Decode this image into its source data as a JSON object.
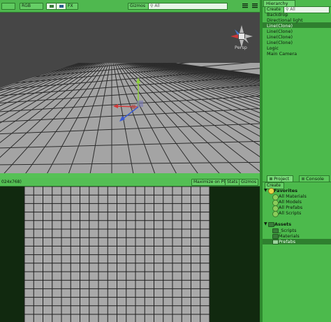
{
  "scene": {
    "toolbar": {
      "render_mode": "RGB",
      "gizmos_label": "Gizmos",
      "search_placeholder": "All",
      "fx_label": "FX"
    },
    "persp_label": "Persp"
  },
  "game": {
    "resolution_label": "024x768)",
    "maximize_label": "Maximize on Play",
    "stats_label": "Stats",
    "gizmos_label": "Gizmos"
  },
  "hierarchy": {
    "tab_label": "Hierarchy",
    "create_label": "Create",
    "search_placeholder": "All",
    "items": [
      {
        "label": "Backdrop",
        "selected": false
      },
      {
        "label": "Directional light",
        "selected": false
      },
      {
        "label": "Line(Clone)",
        "selected": true
      },
      {
        "label": "Line(Clone)",
        "selected": false
      },
      {
        "label": "Line(Clone)",
        "selected": false
      },
      {
        "label": "Line(Clone)",
        "selected": false
      },
      {
        "label": "Logic",
        "selected": false
      },
      {
        "label": "Main Camera",
        "selected": false
      }
    ]
  },
  "project": {
    "tabs": [
      "Project",
      "Console"
    ],
    "create_label": "Create",
    "favorites": {
      "label": "Favorites",
      "items": [
        "All Materials",
        "All Models",
        "All Prefabs",
        "All Scripts"
      ]
    },
    "assets": {
      "label": "Assets",
      "items": [
        {
          "label": "_Scripts",
          "selected": false
        },
        {
          "label": "Materials",
          "selected": false
        },
        {
          "label": "Prefabs",
          "selected": true
        }
      ]
    }
  },
  "colors": {
    "panel_green": "#4cba4c",
    "selection": "#2f7f2f",
    "scene_background": "#464646",
    "game_background": "#11290f"
  }
}
